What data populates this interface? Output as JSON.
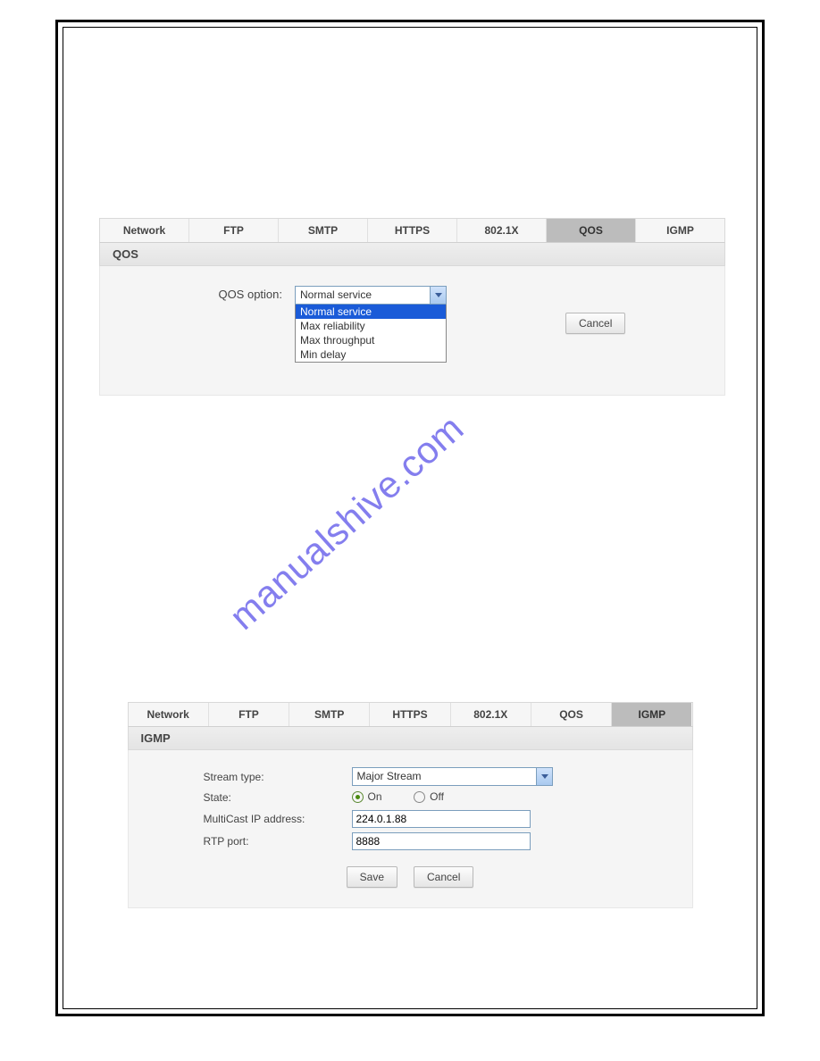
{
  "watermark_text": "manualshive.com",
  "qos": {
    "tabs": [
      "Network",
      "FTP",
      "SMTP",
      "HTTPS",
      "802.1X",
      "QOS",
      "IGMP"
    ],
    "active_tab_index": 5,
    "subheader": "QOS",
    "option_label": "QOS option:",
    "selected_value": "Normal service",
    "dropdown_items": [
      "Normal service",
      "Max reliability",
      "Max throughput",
      "Min delay"
    ],
    "highlighted_item_index": 0,
    "cancel_label": "Cancel"
  },
  "igmp": {
    "tabs": [
      "Network",
      "FTP",
      "SMTP",
      "HTTPS",
      "802.1X",
      "QOS",
      "IGMP"
    ],
    "active_tab_index": 6,
    "subheader": "IGMP",
    "stream_type_label": "Stream type:",
    "stream_type_value": "Major Stream",
    "state_label": "State:",
    "state_on_label": "On",
    "state_off_label": "Off",
    "state_value": "On",
    "multicast_label": "MultiCast IP address:",
    "multicast_value": "224.0.1.88",
    "rtp_label": "RTP port:",
    "rtp_value": "8888",
    "save_label": "Save",
    "cancel_label": "Cancel"
  }
}
